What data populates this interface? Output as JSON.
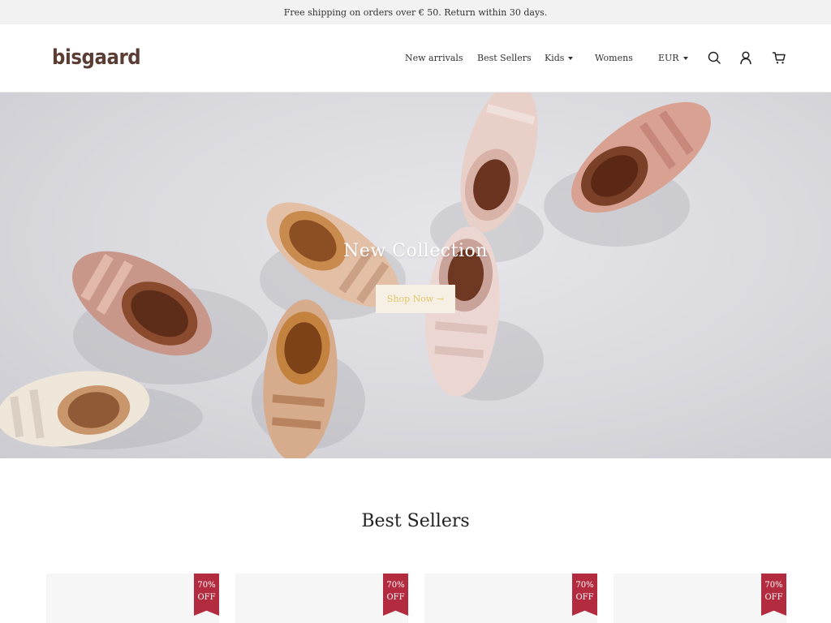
{
  "announcement": "Free shipping on orders over € 50. Return within 30 days.",
  "brand": {
    "logo": "bisgaard",
    "color": "#5a3d35"
  },
  "nav": {
    "items": [
      {
        "label": "New arrivals",
        "has_dropdown": false
      },
      {
        "label": "Best Sellers",
        "has_dropdown": false
      },
      {
        "label": "Kids",
        "has_dropdown": true
      },
      {
        "label": "Womens",
        "has_dropdown": false
      }
    ],
    "currency": "EUR",
    "icons": [
      "search-icon",
      "account-icon",
      "cart-icon"
    ]
  },
  "hero": {
    "title": "New Collection",
    "button_label": "Shop Now →"
  },
  "best_sellers": {
    "title": "Best Sellers",
    "products": [
      {
        "badge_percent": "70%",
        "badge_text": "OFF"
      },
      {
        "badge_percent": "70%",
        "badge_text": "OFF"
      },
      {
        "badge_percent": "70%",
        "badge_text": "OFF"
      },
      {
        "badge_percent": "70%",
        "badge_text": "OFF"
      }
    ]
  },
  "colors": {
    "badge": "#b32b3f",
    "announcement_bg": "#f2f2f2",
    "button_bg": "#f5f0e3"
  }
}
